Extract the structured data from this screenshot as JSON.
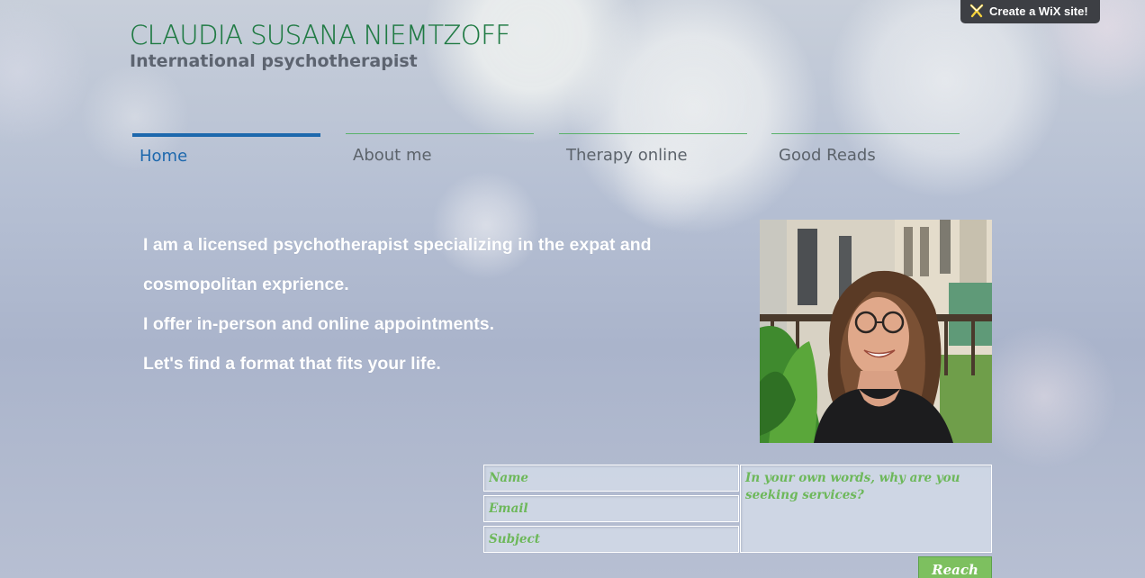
{
  "header": {
    "title": "CLAUDIA SUSANA NIEMTZOFF",
    "subtitle": "International psychotherapist"
  },
  "wix_banner": {
    "label": "Create a WiX site!",
    "icon": "wix-star-icon"
  },
  "nav": {
    "items": [
      {
        "label": "Home",
        "active": true
      },
      {
        "label": "About me",
        "active": false
      },
      {
        "label": "Therapy online",
        "active": false
      },
      {
        "label": "Good Reads",
        "active": false
      }
    ]
  },
  "intro": {
    "lines": [
      "I am a licensed psychotherapist specializing in the expat and",
      "cosmopolitan exprience.",
      "I offer in-person and online appointments.",
      "Let's find a format that fits your life."
    ]
  },
  "photo": {
    "alt": "portrait-photo"
  },
  "contact_form": {
    "name_placeholder": "Name",
    "email_placeholder": "Email",
    "subject_placeholder": "Subject",
    "message_placeholder": "In your own words, why are you seeking services?",
    "submit_label": "Reach out"
  },
  "colors": {
    "title_green": "#1f7a43",
    "nav_active_blue": "#1d68ad",
    "nav_line_green": "#59b26a",
    "form_text_green": "#6db85a",
    "button_green": "#7dc05f",
    "banner_dark": "#3d3f44"
  }
}
